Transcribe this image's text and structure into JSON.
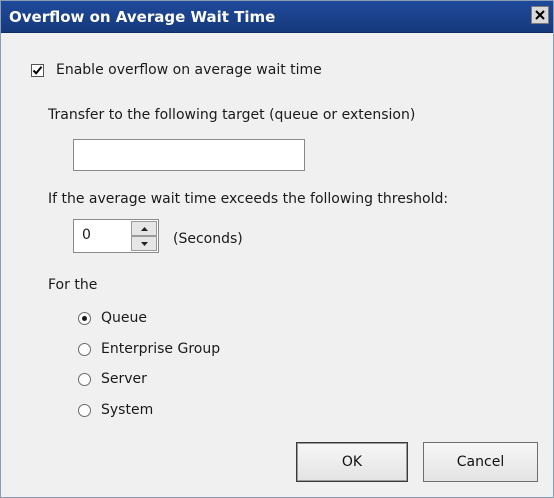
{
  "dialog": {
    "title": "Overflow on Average Wait Time"
  },
  "enable_overflow": {
    "label": "Enable overflow on average wait time",
    "checked": true
  },
  "transfer": {
    "label": "Transfer to the following target (queue or extension)",
    "value": ""
  },
  "threshold": {
    "label": "If the average wait time exceeds the following threshold:",
    "value": "0",
    "unit": "(Seconds)"
  },
  "scope": {
    "label": "For the",
    "options": [
      {
        "label": "Queue",
        "selected": true
      },
      {
        "label": "Enterprise Group",
        "selected": false
      },
      {
        "label": "Server",
        "selected": false
      },
      {
        "label": "System",
        "selected": false
      }
    ]
  },
  "buttons": {
    "ok": "OK",
    "cancel": "Cancel"
  }
}
